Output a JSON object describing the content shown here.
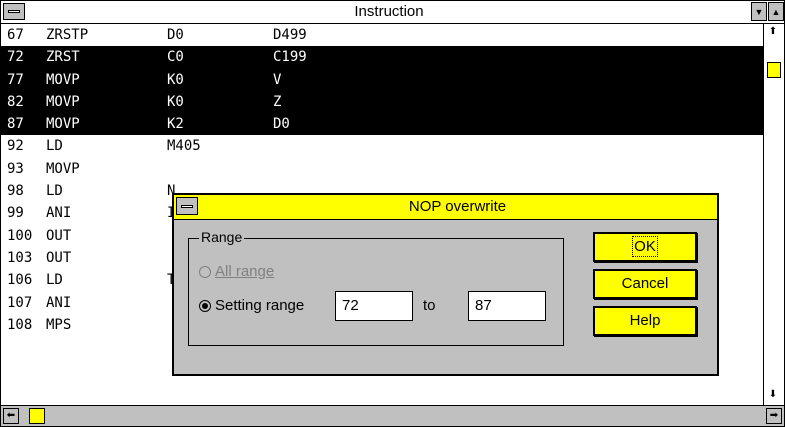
{
  "window": {
    "title": "Instruction"
  },
  "rows": [
    {
      "step": "67",
      "instr": "ZRSTP",
      "op1": "D0",
      "op2": "D499",
      "selected": false
    },
    {
      "step": "72",
      "instr": "ZRST",
      "op1": "C0",
      "op2": "C199",
      "selected": true
    },
    {
      "step": "77",
      "instr": "MOVP",
      "op1": "K0",
      "op2": "V",
      "selected": true
    },
    {
      "step": "82",
      "instr": "MOVP",
      "op1": "K0",
      "op2": "Z",
      "selected": true
    },
    {
      "step": "87",
      "instr": "MOVP",
      "op1": "K2",
      "op2": "D0",
      "selected": true
    },
    {
      "step": "92",
      "instr": "LD",
      "op1": "M405",
      "op2": "",
      "selected": false
    },
    {
      "step": "93",
      "instr": "MOVP",
      "op1": "",
      "op2": "",
      "selected": false
    },
    {
      "step": "98",
      "instr": "LD",
      "op1": "N",
      "op2": "",
      "selected": false
    },
    {
      "step": "99",
      "instr": "ANI",
      "op1": "I",
      "op2": "",
      "selected": false
    },
    {
      "step": "100",
      "instr": "OUT",
      "op1": "",
      "op2": "",
      "selected": false
    },
    {
      "step": "103",
      "instr": "OUT",
      "op1": "",
      "op2": "",
      "selected": false
    },
    {
      "step": "106",
      "instr": "LD",
      "op1": "T",
      "op2": "",
      "selected": false
    },
    {
      "step": "107",
      "instr": "ANI",
      "op1": "",
      "op2": "",
      "selected": false
    },
    {
      "step": "108",
      "instr": "MPS",
      "op1": "",
      "op2": "",
      "selected": false
    }
  ],
  "dialog": {
    "title": "NOP overwrite",
    "group_label": "Range",
    "all_range": {
      "label": "All range",
      "enabled": false,
      "checked": false
    },
    "setting_range": {
      "label": "Setting range",
      "checked": true
    },
    "from_value": "72",
    "to_label": "to",
    "to_value": "87",
    "buttons": {
      "ok": "OK",
      "cancel": "Cancel",
      "help": "Help"
    }
  },
  "colors": {
    "selection": "#000000",
    "dialog_accent": "#ffff00",
    "dialog_body": "#c0c0c0"
  }
}
